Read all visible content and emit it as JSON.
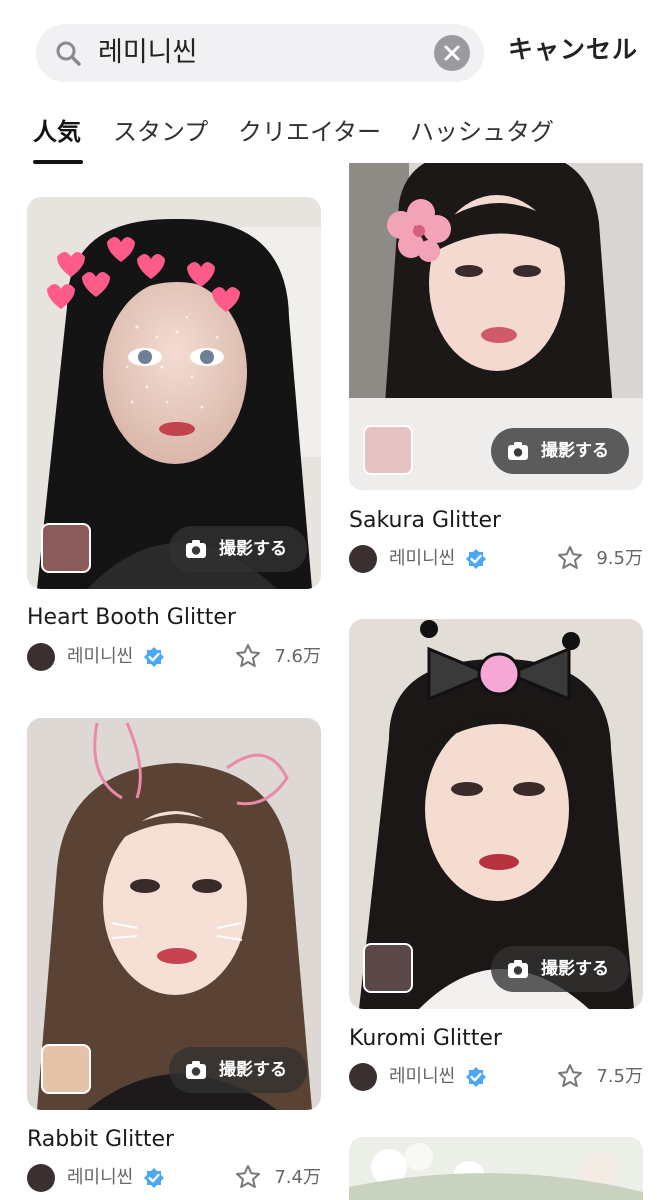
{
  "search": {
    "query": "레미니씬",
    "cancel_label": "キャンセル"
  },
  "tabs": [
    {
      "label": "人気",
      "active": true
    },
    {
      "label": "スタンプ"
    },
    {
      "label": "クリエイター"
    },
    {
      "label": "ハッシュタグ"
    }
  ],
  "shoot_label": "撮影する",
  "cards": [
    {
      "title": "Heart Booth Glitter",
      "creator": "레미니씬",
      "count": "7.6万",
      "sticker": "heart-stickers"
    },
    {
      "title": "Sakura Glitter",
      "creator": "레미니씬",
      "count": "9.5万",
      "sticker": "sakura-flower"
    },
    {
      "title": "Kuromi Glitter",
      "creator": "레미니씬",
      "count": "7.5万",
      "sticker": "kuromi-bow"
    },
    {
      "title": "Rabbit Glitter",
      "creator": "레미니씬",
      "count": "7.4万",
      "sticker": "rabbit-ears"
    }
  ],
  "colors": {
    "verified": "#4aa8f5",
    "button_bg": "#3a3a3a",
    "search_bg": "#f1f1f3"
  },
  "icons": [
    "search-icon",
    "clear-icon",
    "camera-icon",
    "verified-icon",
    "star-icon"
  ]
}
